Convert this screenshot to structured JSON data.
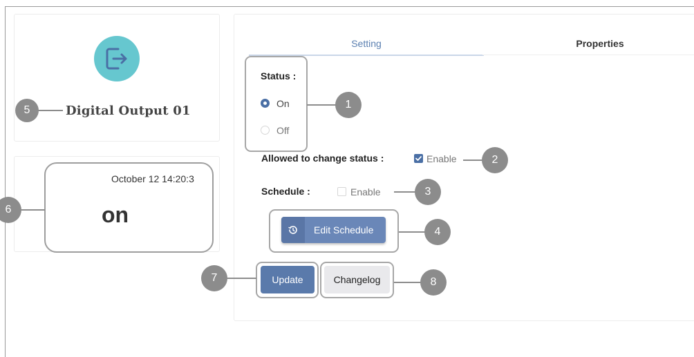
{
  "device": {
    "name": "Digital Output 01",
    "icon": "exit-icon",
    "icon_color": "#66c7cf"
  },
  "status_card": {
    "timestamp": "October 12 14:20:3",
    "value": "on"
  },
  "tabs": {
    "setting": "Setting",
    "properties": "Properties"
  },
  "settings": {
    "status_label": "Status :",
    "options": [
      {
        "label": "On",
        "selected": true
      },
      {
        "label": "Off",
        "selected": false
      }
    ],
    "allowed_label": "Allowed to change status :",
    "allowed_enable": "Enable",
    "allowed_checked": true,
    "schedule_label": "Schedule :",
    "schedule_enable": "Enable",
    "schedule_checked": false
  },
  "buttons": {
    "edit_schedule": "Edit Schedule",
    "update": "Update",
    "changelog": "Changelog"
  },
  "callouts": {
    "c1": "1",
    "c2": "2",
    "c3": "3",
    "c4": "4",
    "c5": "5",
    "c6": "6",
    "c7": "7",
    "c8": "8"
  },
  "colors": {
    "accent": "#4a6fa5",
    "button": "#5a7aab",
    "callout": "#8c8c8c"
  }
}
